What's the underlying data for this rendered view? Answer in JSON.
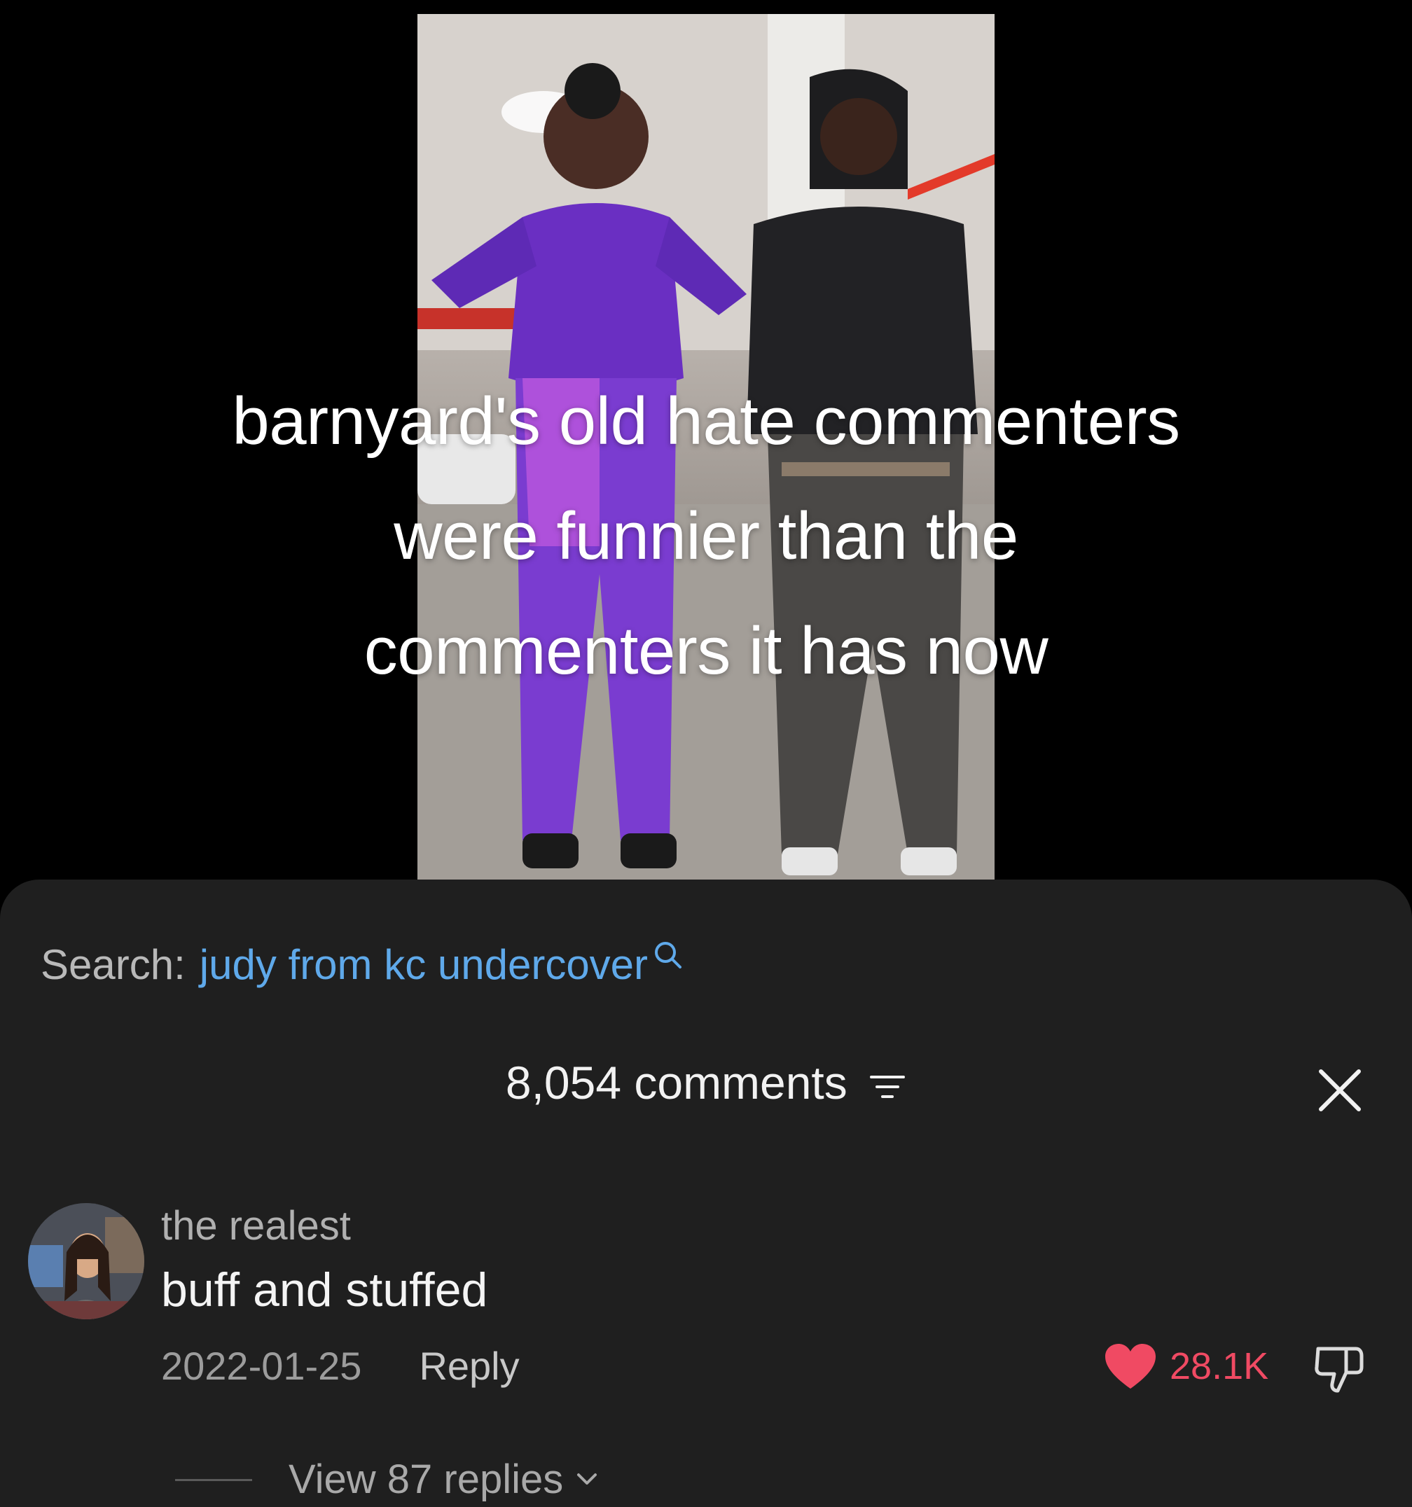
{
  "video": {
    "caption_lines": [
      "barnyard's old hate commenters",
      "were funnier than the",
      "commenters it has now"
    ]
  },
  "search": {
    "prefix": "Search:",
    "term": "judy from kc undercover",
    "icon": "search-icon"
  },
  "comments_header": {
    "count_label": "8,054 comments",
    "filter_icon": "filter-icon",
    "close_icon": "close-icon"
  },
  "comment": {
    "username": "the realest",
    "text": "buff and stuffed",
    "date": "2022-01-25",
    "reply_label": "Reply",
    "like_count": "28.1K",
    "liked": true,
    "like_color": "#f04a63",
    "view_replies_label": "View 87 replies"
  },
  "colors": {
    "background": "#000000",
    "sheet": "#1f1f1f",
    "search_link": "#5fa9ea",
    "like": "#f04a63"
  }
}
